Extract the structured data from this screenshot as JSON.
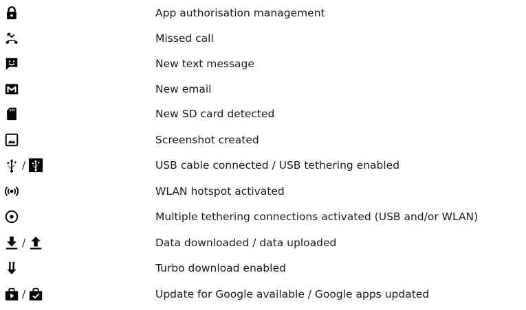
{
  "rows": [
    {
      "icons": [
        "lock-icon"
      ],
      "label": "App authorisation management"
    },
    {
      "icons": [
        "missed-call-icon"
      ],
      "label": "Missed call"
    },
    {
      "icons": [
        "text-message-icon"
      ],
      "label": "New text message"
    },
    {
      "icons": [
        "gmail-icon"
      ],
      "label": "New email"
    },
    {
      "icons": [
        "sd-card-icon"
      ],
      "label": "New SD card detected"
    },
    {
      "icons": [
        "screenshot-icon"
      ],
      "label": "Screenshot created"
    },
    {
      "icons": [
        "usb-icon",
        "usb-tethering-icon"
      ],
      "separator": "/",
      "label": "USB cable connected / USB tethering enabled"
    },
    {
      "icons": [
        "wlan-hotspot-icon"
      ],
      "label": "WLAN hotspot activated"
    },
    {
      "icons": [
        "multiple-tethering-icon"
      ],
      "label": "Multiple tethering connections activated (USB and/or WLAN)"
    },
    {
      "icons": [
        "download-icon",
        "upload-icon"
      ],
      "separator": "/",
      "label": "Data downloaded / data uploaded"
    },
    {
      "icons": [
        "turbo-download-icon"
      ],
      "label": "Turbo download enabled"
    },
    {
      "icons": [
        "play-store-update-icon",
        "play-store-updated-icon"
      ],
      "separator": "/",
      "label": "Update for Google available / Google apps updated"
    }
  ],
  "colors": {
    "icon": "#000000",
    "text": "#1a1a1a",
    "background": "#ffffff"
  }
}
